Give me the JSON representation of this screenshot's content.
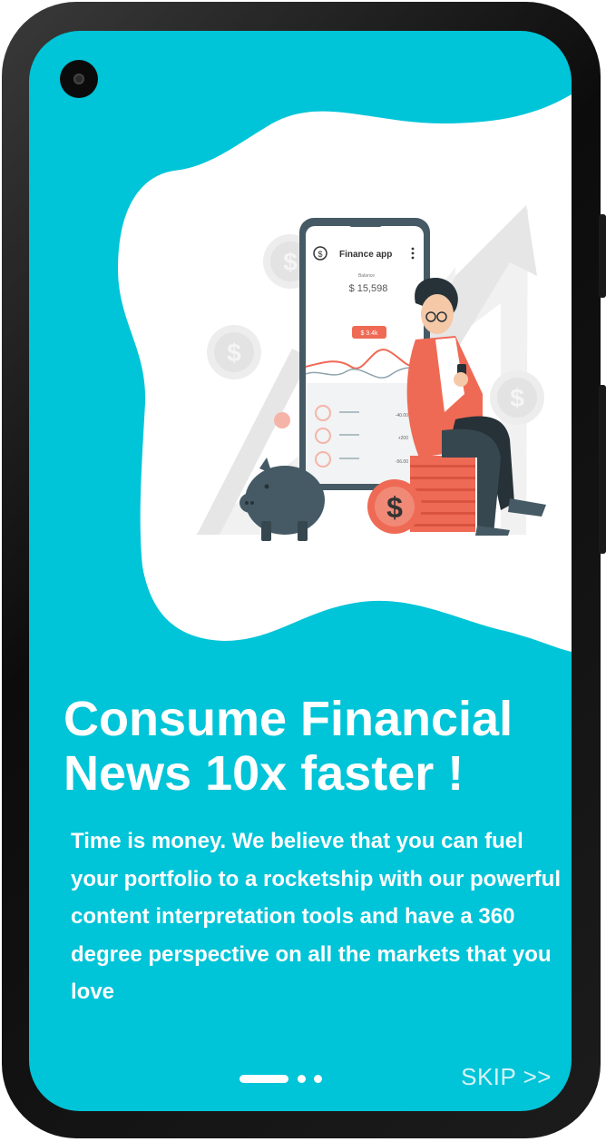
{
  "colors": {
    "screen_background": "#00c4d8",
    "text": "#ffffff",
    "skip_text": "#d6f3f6",
    "illustration_accent": "#ef6a55",
    "illustration_dark": "#455a64"
  },
  "illustration": {
    "phone_app_title": "Finance app",
    "balance_label": "Balance",
    "balance_value": "$ 15,598",
    "chart_badge": "$ 3.4k",
    "transactions": [
      "-40.00",
      "+200",
      "-56.00"
    ]
  },
  "onboarding": {
    "headline_line1": "Consume Financial",
    "headline_line2": "News 10x faster !",
    "description": "Time is money. We believe that you can fuel your portfolio to a rocketship with our powerful content interpretation tools and have a 360 degree perspective on all the markets that you love"
  },
  "pagination": {
    "total_pages": 3,
    "current_page": 1
  },
  "skip_label": "SKIP >>",
  "icons": [
    "camera-icon",
    "dollar-coin-icon",
    "piggy-bank-icon",
    "growth-arrow-icon",
    "kebab-menu-icon"
  ]
}
